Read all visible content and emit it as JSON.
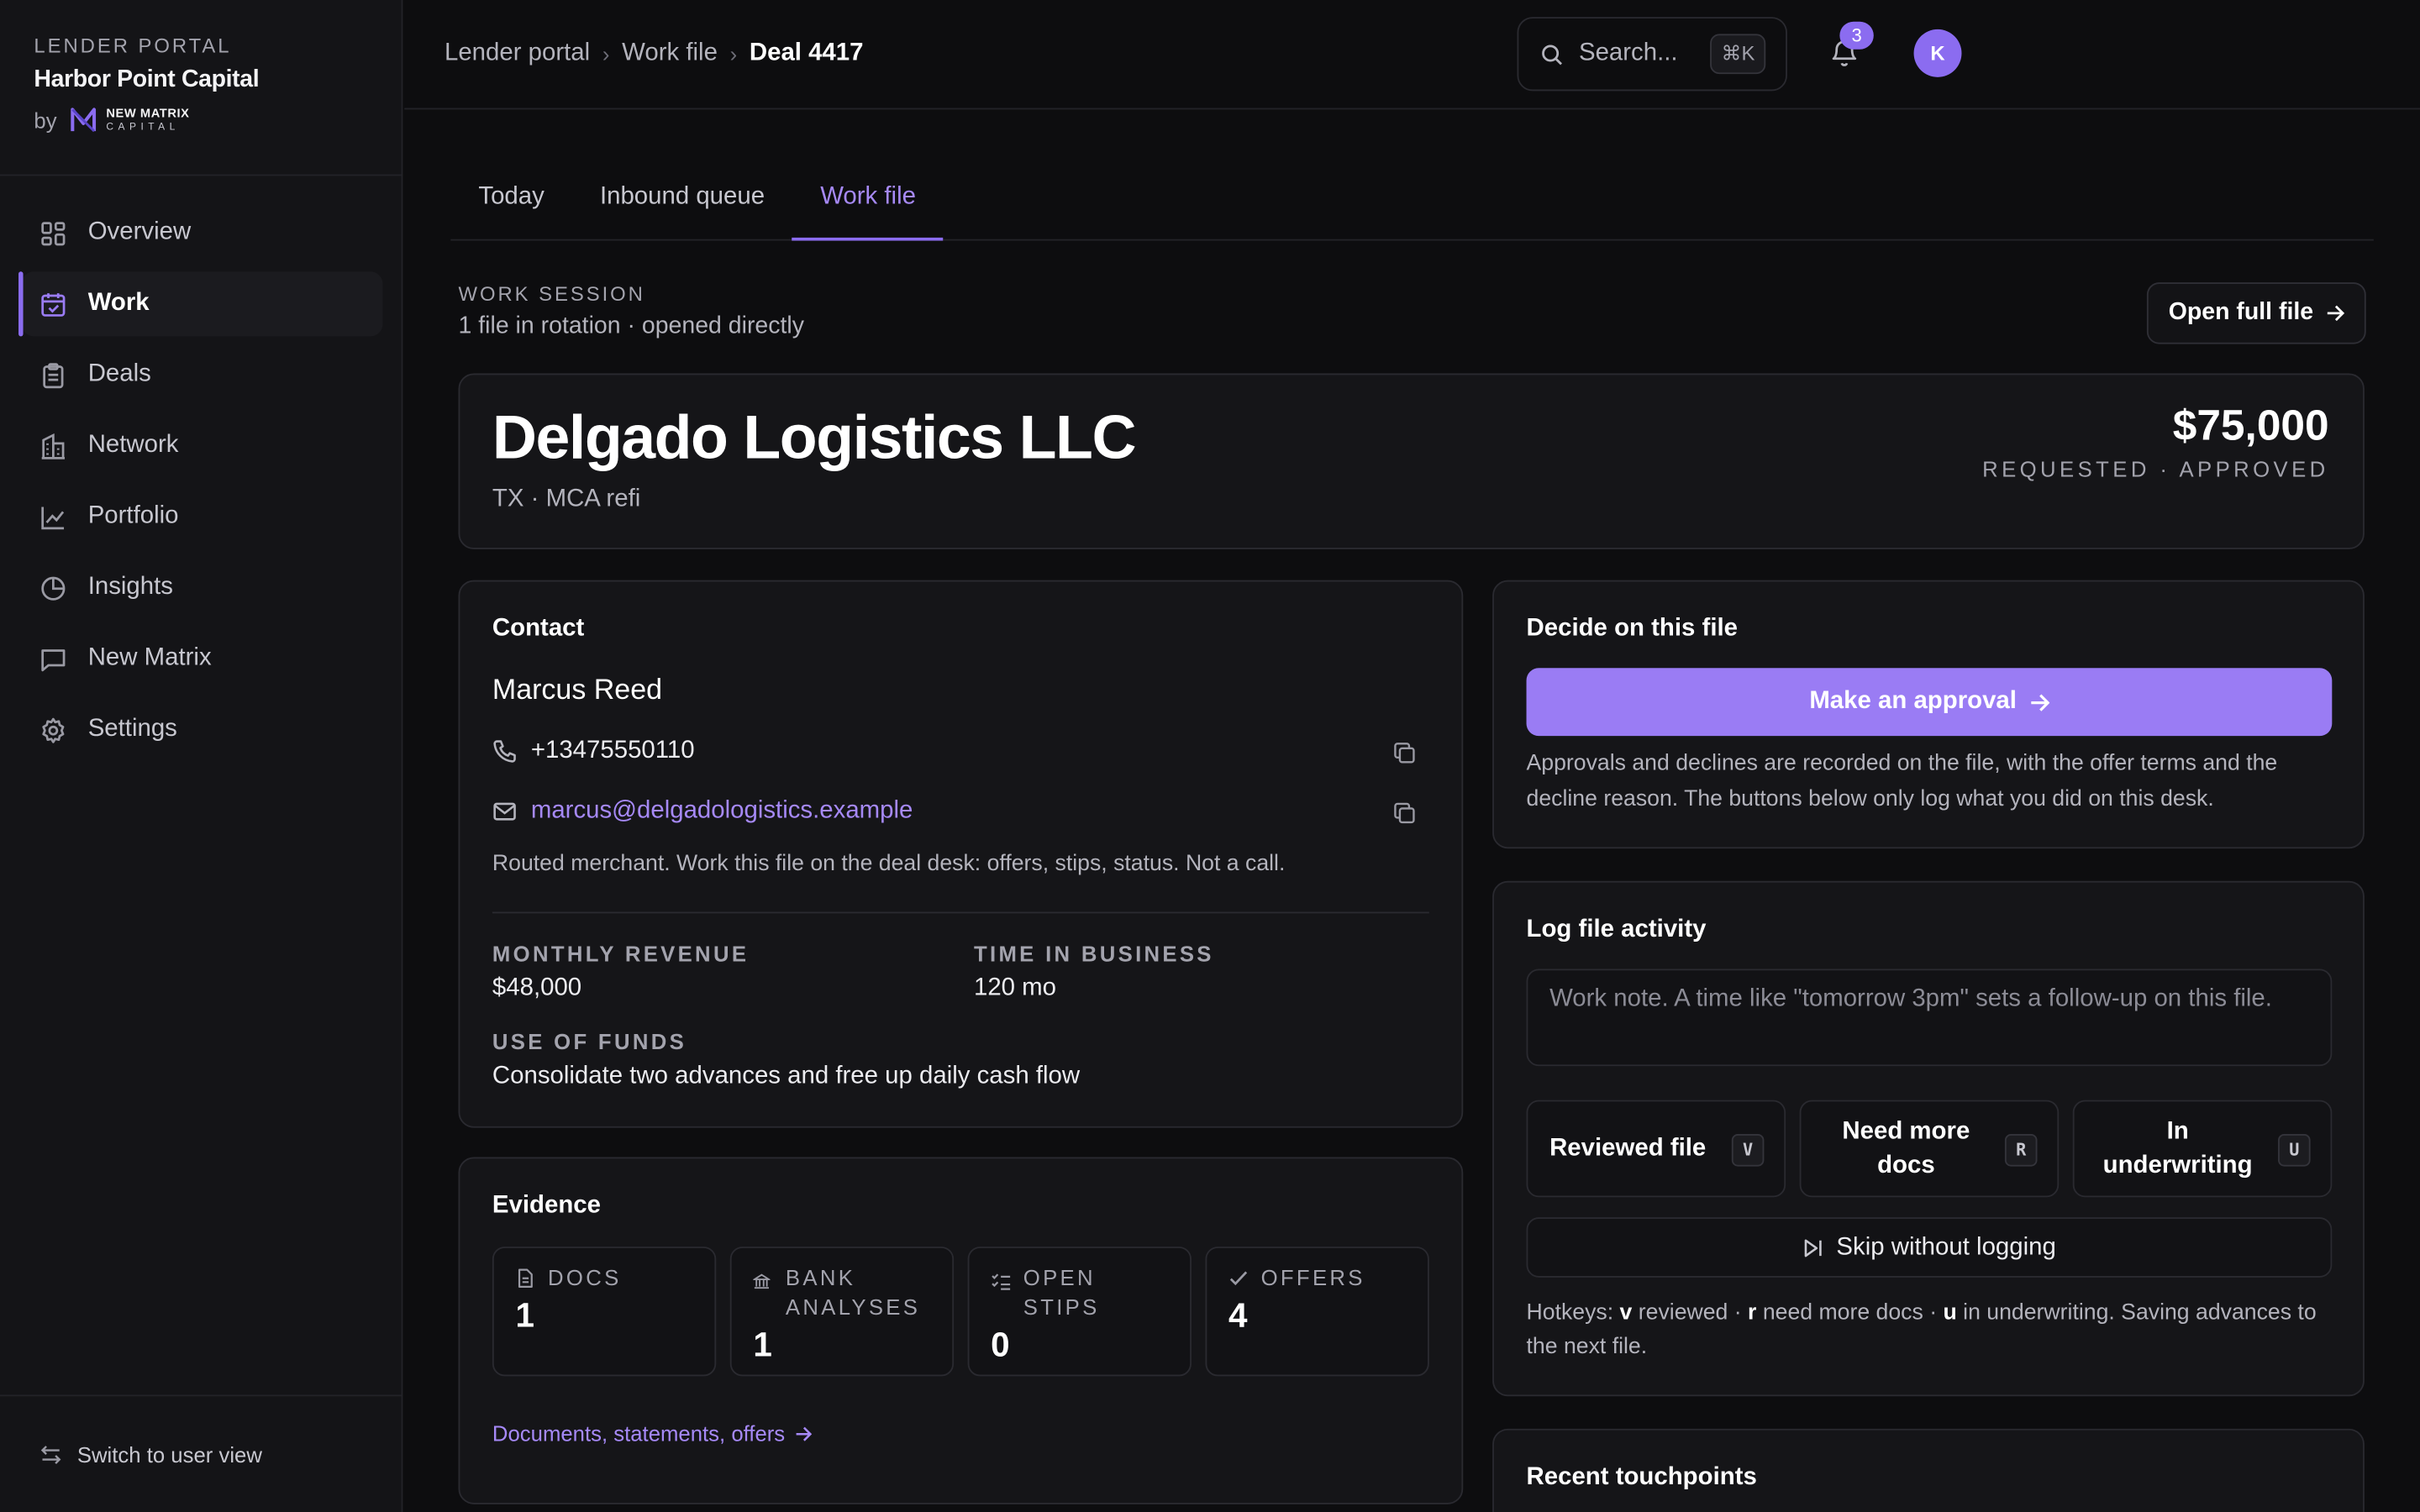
{
  "brand": {
    "eyebrow": "LENDER PORTAL",
    "name": "Harbor Point Capital",
    "by": "by",
    "logo_line1": "NEW MATRIX",
    "logo_line2": "CAPITAL"
  },
  "sidebar": {
    "items": [
      {
        "label": "Overview",
        "icon": "grid-icon"
      },
      {
        "label": "Work",
        "icon": "calendar-check-icon",
        "active": true
      },
      {
        "label": "Deals",
        "icon": "clipboard-icon"
      },
      {
        "label": "Network",
        "icon": "building-icon"
      },
      {
        "label": "Portfolio",
        "icon": "line-chart-icon"
      },
      {
        "label": "Insights",
        "icon": "pie-chart-icon"
      },
      {
        "label": "New Matrix",
        "icon": "message-icon"
      },
      {
        "label": "Settings",
        "icon": "gear-icon"
      }
    ],
    "switch_label": "Switch to user view"
  },
  "breadcrumb": [
    "Lender portal",
    "Work file",
    "Deal 4417"
  ],
  "search": {
    "placeholder": "Search...",
    "shortcut": "⌘K"
  },
  "notifications": {
    "count": "3"
  },
  "avatar": {
    "initial": "K"
  },
  "tabs": [
    "Today",
    "Inbound queue",
    "Work file"
  ],
  "active_tab": "Work file",
  "session": {
    "eyebrow": "WORK SESSION",
    "subtitle": "1 file in rotation · opened directly",
    "open_full_label": "Open full file"
  },
  "deal": {
    "company": "Delgado Logistics LLC",
    "subtitle": "TX · MCA refi",
    "amount": "$75,000",
    "status": "REQUESTED · APPROVED"
  },
  "contact": {
    "title": "Contact",
    "name": "Marcus Reed",
    "phone": "+13475550110",
    "email": "marcus@delgadologistics.example",
    "note": "Routed merchant. Work this file on the deal desk: offers, stips, status. Not a call.",
    "monthly_revenue_label": "MONTHLY REVENUE",
    "monthly_revenue": "$48,000",
    "time_in_business_label": "TIME IN BUSINESS",
    "time_in_business": "120 mo",
    "use_of_funds_label": "USE OF FUNDS",
    "use_of_funds": "Consolidate two advances and free up daily cash flow"
  },
  "evidence": {
    "title": "Evidence",
    "boxes": [
      {
        "label": "DOCS",
        "value": "1",
        "icon": "document-icon"
      },
      {
        "label_line1": "BANK",
        "label_line2": "ANALYSES",
        "value": "1",
        "icon": "bank-icon"
      },
      {
        "label_line1": "OPEN",
        "label_line2": "STIPS",
        "value": "0",
        "icon": "checklist-icon"
      },
      {
        "label": "OFFERS",
        "value": "4",
        "icon": "check-icon"
      }
    ],
    "link_label": "Documents, statements, offers"
  },
  "decide": {
    "title": "Decide on this file",
    "approve_label": "Make an approval",
    "note": "Approvals and declines are recorded on the file, with the offer terms and the decline reason. The buttons below only log what you did on this desk."
  },
  "log": {
    "title": "Log file activity",
    "placeholder": "Work note. A time like \"tomorrow 3pm\" sets a follow-up on this file.",
    "buttons": [
      {
        "label": "Reviewed file",
        "key": "V"
      },
      {
        "label": "Need more docs",
        "key": "R"
      },
      {
        "label": "In underwriting",
        "key": "U"
      }
    ],
    "skip_label": "Skip without logging",
    "hotkeys": {
      "prefix": "Hotkeys: ",
      "k1": "v",
      "t1": " reviewed · ",
      "k2": "r",
      "t2": " need more docs · ",
      "k3": "u",
      "t3": " in underwriting. Saving advances to the next file."
    }
  },
  "recent": {
    "title": "Recent touchpoints"
  },
  "colors": {
    "accent": "#8b6cf0",
    "accent_button": "#9a7cf4",
    "link": "#a689f7",
    "background": "#0d0d0f",
    "card": "#151518"
  }
}
